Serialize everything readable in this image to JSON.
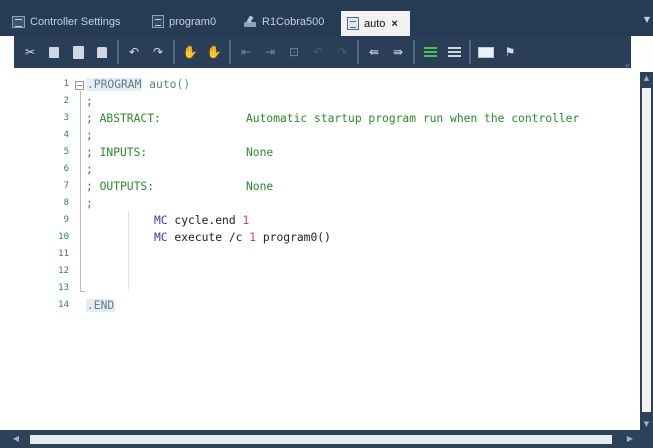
{
  "tabs": [
    {
      "label": "Controller Settings",
      "icon": "settings-grid-icon",
      "active": false
    },
    {
      "label": "program0",
      "icon": "program-doc-icon",
      "active": false
    },
    {
      "label": "R1Cobra500",
      "icon": "robot-arm-icon",
      "active": false
    },
    {
      "label": "auto",
      "icon": "program-doc-icon",
      "active": true,
      "close": "×"
    }
  ],
  "toolbar": {
    "buttons": [
      "cut-icon",
      "copy-icon",
      "paste-icon",
      "delete-icon",
      "undo-icon",
      "redo-icon",
      "hand-icon",
      "hand-stop-icon",
      "breakpoint-icon",
      "breakpoint-clear-icon",
      "step-over-icon",
      "undo-green-icon",
      "redo-green-icon",
      "outdent-icon",
      "indent-icon",
      "comment-icon",
      "uncomment-icon",
      "monitor-icon",
      "flag-icon"
    ]
  },
  "editor": {
    "line_numbers": [
      "1",
      "2",
      "3",
      "4",
      "5",
      "6",
      "7",
      "8",
      "9",
      "10",
      "11",
      "12",
      "13",
      "14"
    ],
    "lines": {
      "l1_keyword": ".PROGRAM",
      "l1_name": "auto()",
      "l2": ";",
      "l3_label": "; ABSTRACT:",
      "l3_value": "Automatic startup program run when the controller",
      "l4": ";",
      "l5_label": "; INPUTS:",
      "l5_value": "None",
      "l6": ";",
      "l7_label": "; OUTPUTS:",
      "l7_value": "None",
      "l8": ";",
      "l9_mc": "MC",
      "l9_cmd": "cycle.end",
      "l9_num": "1",
      "l10_mc": "MC",
      "l10_cmd": "execute /c",
      "l10_num": "1",
      "l10_arg": "program0()",
      "l13_keyword": ".END"
    }
  },
  "colors": {
    "tabbar": "#263b54",
    "toolbar": "#2a3f57",
    "comment": "#2b8a2b",
    "keyword": "#5d7f88",
    "mc": "#3a3f9a",
    "number": "#c0504d",
    "line_number": "#2f7a90"
  }
}
